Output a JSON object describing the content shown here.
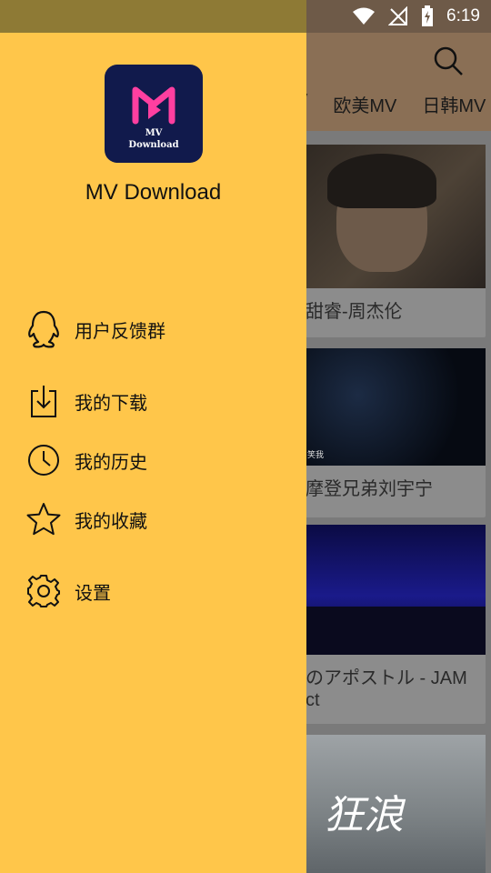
{
  "status_bar": {
    "time": "6:19"
  },
  "app_bar": {
    "search_icon": "search-icon",
    "tabs": [
      {
        "label": "V"
      },
      {
        "label": "欧美MV"
      },
      {
        "label": "日韩MV"
      }
    ]
  },
  "videos": [
    {
      "title": "甜睿-周杰伦",
      "caption": ""
    },
    {
      "title": "摩登兄弟刘宇宁",
      "caption": "笑我"
    },
    {
      "title": "のアポストル - JAM\nct"
    },
    {
      "title": "",
      "overlay": "狂浪"
    }
  ],
  "drawer": {
    "logo": {
      "line1": "MV",
      "line2": "Download"
    },
    "app_name": "MV Download",
    "menu": [
      {
        "label": "用户反馈群",
        "icon": "qq-icon"
      },
      {
        "label": "我的下载",
        "icon": "download-icon"
      },
      {
        "label": "我的历史",
        "icon": "clock-icon"
      },
      {
        "label": "我的收藏",
        "icon": "star-icon"
      },
      {
        "label": "设置",
        "icon": "gear-icon"
      }
    ]
  },
  "colors": {
    "drawer_bg": "#ffc64a",
    "logo_bg": "#111a4c",
    "logo_accent": "#ff3fa0"
  }
}
